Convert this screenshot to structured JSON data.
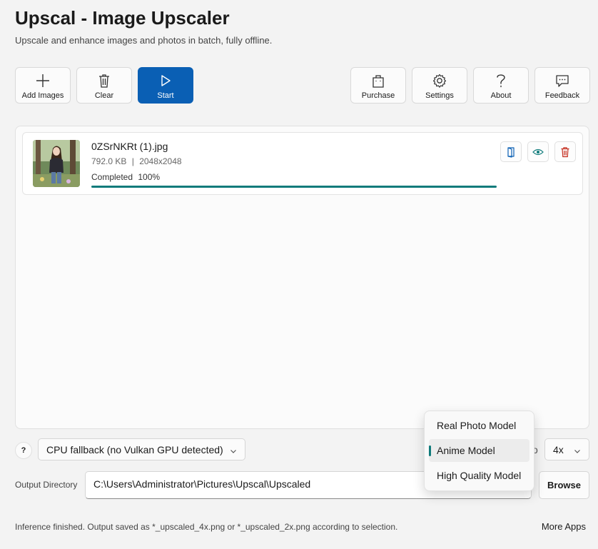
{
  "app": {
    "title": "Upscal - Image Upscaler",
    "subtitle": "Upscale and enhance images and photos in batch, fully offline."
  },
  "toolbar": {
    "add_images": "Add Images",
    "clear": "Clear",
    "start": "Start",
    "purchase": "Purchase",
    "settings": "Settings",
    "about": "About",
    "feedback": "Feedback"
  },
  "files": [
    {
      "name": "0ZSrNKRt (1).jpg",
      "size": "792.0 KB",
      "separator": "|",
      "dimensions": "2048x2048",
      "status": "Completed",
      "percent_label": "100%",
      "progress": 1.0
    }
  ],
  "controls": {
    "help_label": "?",
    "device": "CPU fallback (no Vulkan GPU detected)",
    "scale_label_fragment": "o",
    "scale": "4x"
  },
  "model_dropdown": {
    "options": [
      "Real Photo Model",
      "Anime Model",
      "High Quality Model"
    ],
    "selected": "Anime Model"
  },
  "output": {
    "label": "Output Directory",
    "path": "C:\\Users\\Administrator\\Pictures\\Upscal\\Upscaled",
    "browse": "Browse"
  },
  "status_bar": {
    "message": "Inference finished. Output saved as *_upscaled_4x.png or *_upscaled_2x.png according to selection.",
    "more_apps": "More Apps"
  },
  "colors": {
    "accent": "#0a5fb4",
    "progress": "#0f7b7b",
    "delete": "#c42b1c"
  }
}
